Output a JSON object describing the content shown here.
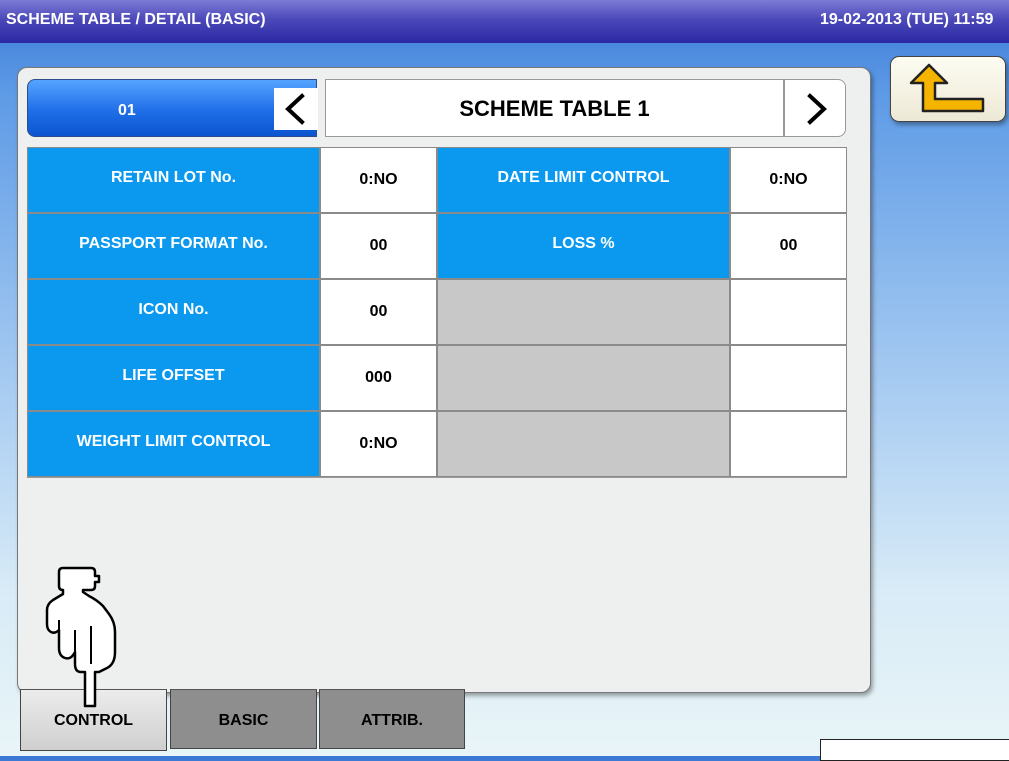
{
  "title": "SCHEME TABLE / DETAIL (BASIC)",
  "datetime": "19-02-2013 (TUE)  11:59",
  "back_icon": "return-arrow-icon",
  "header": {
    "number": "01",
    "name": "SCHEME TABLE 1",
    "prev_icon": "chevron-left-icon",
    "next_icon": "chevron-right-icon"
  },
  "rows": [
    {
      "left_label": "RETAIN LOT No.",
      "left_value": "0:NO",
      "right_label": "DATE LIMIT CONTROL",
      "right_value": "0:NO"
    },
    {
      "left_label": "PASSPORT FORMAT No.",
      "left_value": "00",
      "right_label": "LOSS %",
      "right_value": "00"
    },
    {
      "left_label": "ICON No.",
      "left_value": "00",
      "right_label": "",
      "right_value": ""
    },
    {
      "left_label": "LIFE OFFSET",
      "left_value": "000",
      "right_label": "",
      "right_value": ""
    },
    {
      "left_label": "WEIGHT LIMIT CONTROL",
      "left_value": "0:NO",
      "right_label": "",
      "right_value": ""
    }
  ],
  "tabs": [
    "CONTROL",
    "BASIC",
    "ATTRIB."
  ],
  "active_tab": "CONTROL",
  "pointer_icon": "hand-pointer-icon",
  "colors": {
    "title_bar": "#2b28a4",
    "label_blue": "#0a99ee",
    "number_button": "#1f6ee8",
    "disabled_cell": "#c8c8c8"
  }
}
